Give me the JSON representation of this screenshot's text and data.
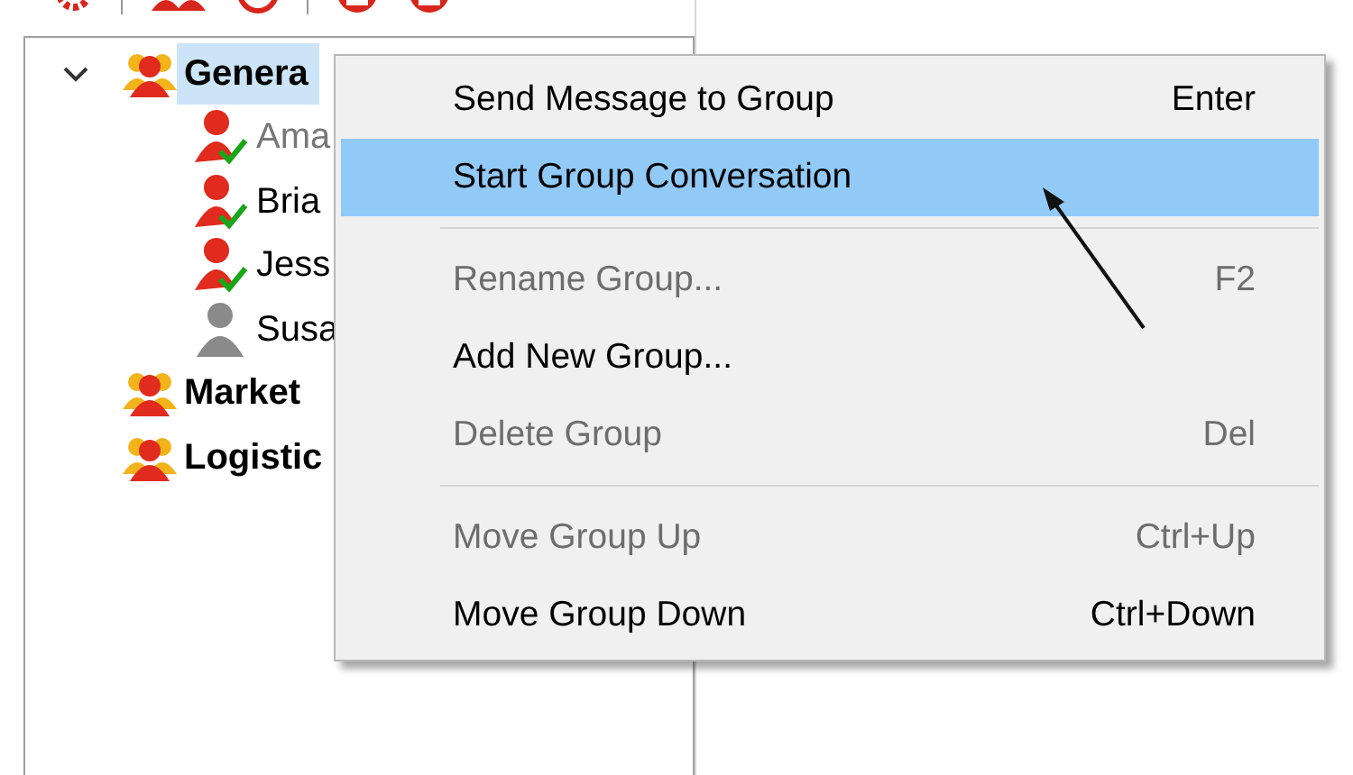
{
  "toolbar": {
    "icons": [
      {
        "kind": "gear"
      },
      {
        "kind": "sep"
      },
      {
        "kind": "users"
      },
      {
        "kind": "ring"
      },
      {
        "kind": "sep"
      },
      {
        "kind": "dot"
      },
      {
        "kind": "dot"
      }
    ]
  },
  "tree": [
    {
      "label": "Genera",
      "expanded": true,
      "selected": true,
      "children": [
        {
          "label": "Ama",
          "kind": "online",
          "dimmed": true
        },
        {
          "label": "Bria",
          "kind": "online",
          "dimmed": false
        },
        {
          "label": "Jess",
          "kind": "online",
          "dimmed": false
        },
        {
          "label": "Susa",
          "kind": "offline",
          "dimmed": false
        }
      ]
    },
    {
      "label": "Market",
      "expanded": false,
      "selected": false
    },
    {
      "label": "Logistic",
      "expanded": false,
      "selected": false
    }
  ],
  "context_menu": [
    {
      "kind": "item",
      "label": "Send Message to Group",
      "shortcut": "Enter",
      "disabled": false,
      "selected": false
    },
    {
      "kind": "item",
      "label": "Start Group Conversation",
      "disabled": false,
      "selected": true
    },
    {
      "kind": "separator"
    },
    {
      "kind": "item",
      "label": "Rename Group...",
      "shortcut": "F2",
      "disabled": true,
      "selected": false
    },
    {
      "kind": "item",
      "label": "Add New Group...",
      "disabled": false,
      "selected": false
    },
    {
      "kind": "item",
      "label": "Delete Group",
      "shortcut": "Del",
      "disabled": true,
      "selected": false
    },
    {
      "kind": "separator"
    },
    {
      "kind": "item",
      "label": "Move Group Up",
      "shortcut": "Ctrl+Up",
      "disabled": true,
      "selected": false
    },
    {
      "kind": "item",
      "label": "Move Group Down",
      "shortcut": "Ctrl+Down",
      "disabled": false,
      "selected": false
    }
  ]
}
